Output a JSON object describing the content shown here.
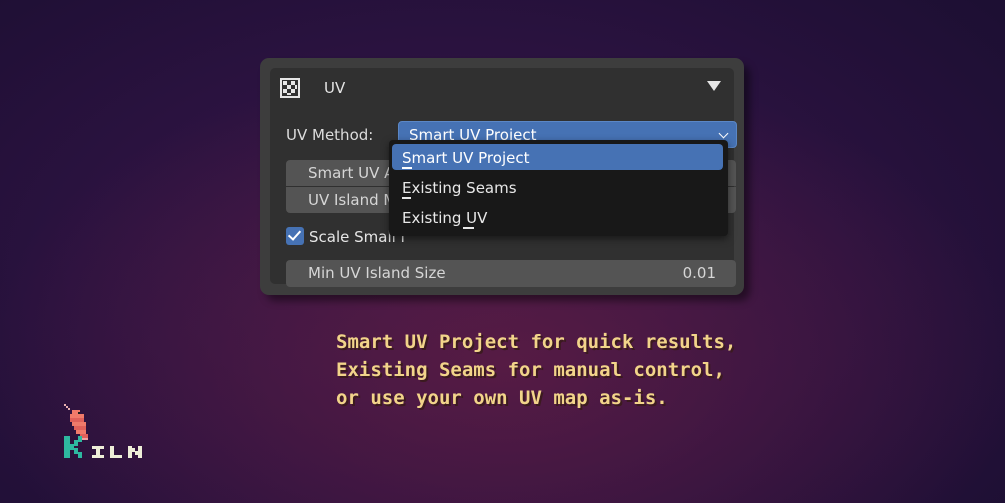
{
  "panel": {
    "title": "UV",
    "header_icon": "checker-texture-icon",
    "collapse_icon": "collapse-triangle-icon",
    "method_label": "UV Method:",
    "method_selected": "Smart UV Project",
    "rows": {
      "angle_label": "Smart UV An",
      "margin_label": "UV Island Ma",
      "scale_checkbox_label": "Scale Small I",
      "scale_checked": true,
      "min_size_label": "Min UV Island Size",
      "min_size_value": "0.01"
    }
  },
  "dropdown": {
    "options": [
      "Smart UV Project",
      "Existing Seams",
      "Existing UV"
    ],
    "selected_index": 0
  },
  "caption": {
    "line1": "Smart UV Project for quick results,",
    "line2": "Existing Seams for manual control,",
    "line3": "or use your own UV map as-is."
  },
  "logo": {
    "text": "KILN",
    "icon": "shrimp-mascot-icon"
  },
  "colors": {
    "accent": "#4672b4",
    "panel_bg": "#303030",
    "panel_border": "#3d3d3d",
    "field_bg": "#545454",
    "dropdown_bg": "#181818",
    "caption_text": "#f2d48a",
    "logo_text": "#eeeed8",
    "logo_k": "#2eb8a0"
  }
}
